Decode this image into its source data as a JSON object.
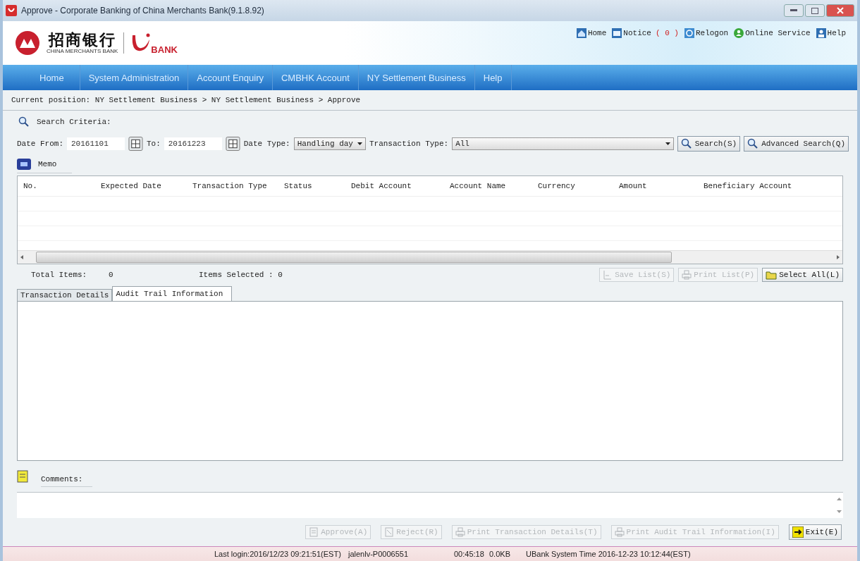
{
  "window": {
    "title": "Approve - Corporate Banking of China Merchants Bank(9.1.8.92)"
  },
  "brand": {
    "name": "招商银行",
    "subtitle": "CHINA MERCHANTS BANK",
    "product": "BANK"
  },
  "top_links": [
    {
      "kind": "home",
      "label": "Home"
    },
    {
      "kind": "notice",
      "label": "Notice",
      "count": "( 0 )"
    },
    {
      "kind": "relogon",
      "label": "Relogon"
    },
    {
      "kind": "service",
      "label": "Online Service"
    },
    {
      "kind": "help",
      "label": "Help"
    }
  ],
  "nav": [
    "Home",
    "System Administration",
    "Account Enquiry",
    "CMBHK Account",
    "NY Settlement Business",
    "Help"
  ],
  "breadcrumb": "Current position: NY Settlement Business > NY Settlement Business > Approve",
  "search_section": "Search Criteria:",
  "filters": {
    "date_from_label": "Date From:",
    "date_from": "20161101",
    "to_label": "To:",
    "date_to": "20161223",
    "date_type_label": "Date Type:",
    "date_type": "Handling day",
    "transaction_type_label": "Transaction Type:",
    "transaction_type": "All"
  },
  "search_buttons": [
    "Search(S)",
    "Advanced Search(Q)"
  ],
  "memo_tab": "Memo",
  "table": {
    "columns": [
      "No.",
      "Expected Date",
      "Transaction Type",
      "Status",
      "Debit Account",
      "Account Name",
      "Currency",
      "Amount",
      "Beneficiary Account"
    ]
  },
  "totals": {
    "total_label": "Total Items:",
    "total": "0",
    "selected_label": "Items Selected : 0"
  },
  "list_buttons": [
    {
      "label": "Save List(S)",
      "disabled": true,
      "kind": "save"
    },
    {
      "label": "Print List(P)",
      "disabled": true,
      "kind": "print"
    },
    {
      "label": "Select All(L)",
      "disabled": false,
      "kind": "select"
    }
  ],
  "detail_tabs": [
    {
      "label": "Transaction Details",
      "selected": false
    },
    {
      "label": "Audit Trail Information",
      "selected": true
    }
  ],
  "comments_label": "Comments:",
  "action_buttons": [
    {
      "label": "Approve(A)",
      "disabled": true,
      "kind": "approve"
    },
    {
      "label": "Reject(R)",
      "disabled": true,
      "kind": "reject"
    },
    {
      "label": "Print Transaction Details(T)",
      "disabled": true,
      "kind": "print"
    },
    {
      "label": "Print Audit Trail Information(I)",
      "disabled": true,
      "kind": "print"
    },
    {
      "label": "Exit(E)",
      "disabled": false,
      "kind": "exit"
    }
  ],
  "status_bar": [
    "Last login:2016/12/23 09:21:51(EST)",
    "jalenlv-P0006551",
    "00:45:18",
    "0.0KB",
    "UBank System Time 2016-12-23 10:12:44(EST)"
  ]
}
